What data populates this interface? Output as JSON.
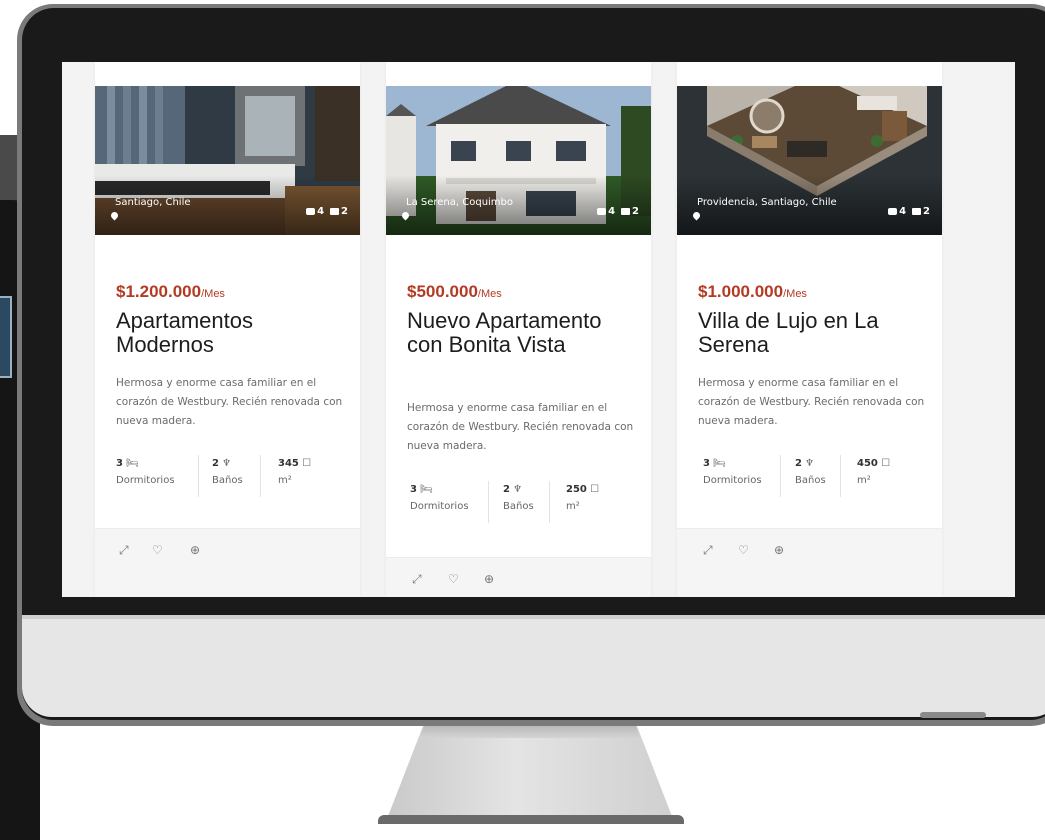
{
  "listings": [
    {
      "location": "Santiago, Chile",
      "photo_count": "4",
      "video_count": "2",
      "price": "$1.200.000",
      "period": "/Mes",
      "title": "Apartamentos Modernos",
      "description": "Hermosa y enorme casa familiar en el corazón de Westbury. Recién renovada con nueva madera.",
      "bedrooms": "3",
      "bedrooms_label": "Dormitorios",
      "baths": "2",
      "baths_label": "Baños",
      "area": "345",
      "area_label": "m²"
    },
    {
      "location": "La Serena, Coquimbo",
      "photo_count": "4",
      "video_count": "2",
      "price": "$500.000",
      "period": "/Mes",
      "title": "Nuevo Apartamento con Bonita Vista",
      "description": "Hermosa y enorme casa familiar en el corazón de Westbury. Recién renovada con nueva madera.",
      "bedrooms": "3",
      "bedrooms_label": "Dormitorios",
      "baths": "2",
      "baths_label": "Baños",
      "area": "250",
      "area_label": "m²"
    },
    {
      "location": "Providencia, Santiago, Chile",
      "photo_count": "4",
      "video_count": "2",
      "price": "$1.000.000",
      "period": "/Mes",
      "title": "Villa de Lujo en La Serena",
      "description": "Hermosa y enorme casa familiar en el corazón de Westbury. Recién renovada con nueva madera.",
      "bedrooms": "3",
      "bedrooms_label": "Dormitorios",
      "baths": "2",
      "baths_label": "Baños",
      "area": "450",
      "area_label": "m²"
    }
  ],
  "icons": {
    "bed": "🛏",
    "bath": "♆",
    "area": "☐",
    "expand": "⤢",
    "favorite": "♡",
    "compare": "⊕"
  },
  "colors": {
    "price": "#b33b24",
    "bezel": "#1a1a1a"
  }
}
